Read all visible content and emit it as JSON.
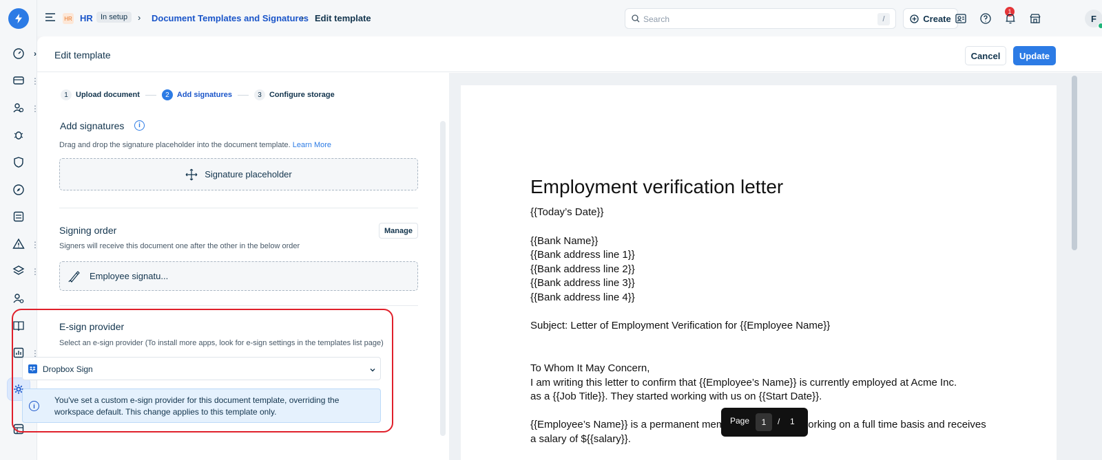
{
  "topbar": {
    "module": "HR",
    "module_status": "In setup",
    "crumb_parent": "Document Templates and Signatures",
    "crumb_current": "Edit template",
    "search_placeholder": "Search",
    "search_shortcut": "/",
    "create_label": "Create",
    "notification_count": "1",
    "avatar_initial": "F"
  },
  "header": {
    "title": "Edit template",
    "cancel_label": "Cancel",
    "update_label": "Update"
  },
  "steps": [
    {
      "num": "1",
      "label": "Upload document"
    },
    {
      "num": "2",
      "label": "Add signatures"
    },
    {
      "num": "3",
      "label": "Configure storage"
    }
  ],
  "signatures": {
    "title": "Add signatures",
    "desc": "Drag and drop the signature placeholder into the document template.",
    "learn_more": "Learn More",
    "placeholder_label": "Signature placeholder"
  },
  "signing_order": {
    "title": "Signing order",
    "manage_label": "Manage",
    "desc": "Signers will receive this document one after the other in the below order",
    "signer_label": "Employee signatu..."
  },
  "esign": {
    "title": "E-sign provider",
    "desc": "Select an e-sign provider (To install more apps, look for e-sign settings in the templates list page)",
    "selected_provider": "Dropbox Sign",
    "note": "You've set a custom e-sign provider for this document template, overriding the workspace default. This change applies to this template only."
  },
  "document": {
    "title": "Employment verification letter",
    "lines": [
      "{{Today’s Date}}",
      "{{Bank Name}}",
      "{{Bank address line 1}}",
      "{{Bank address line 2}}",
      "{{Bank address line 3}}",
      "{{Bank address line 4}}",
      "Subject: Letter of Employment Verification for {{Employee Name}}",
      "To Whom It May Concern,",
      "I am writing this letter to confirm that {{Employee’s Name}} is currently employed at Acme Inc.",
      "as a {{Job Title}}. They started working with us on {{Start Date}}.",
      "{{Employee’s Name}} is a permanent member of our team, working on a full time basis and receives",
      "a salary of ${{salary}}."
    ]
  },
  "pager": {
    "label": "Page",
    "current": "1",
    "separator": "/",
    "total": "1"
  },
  "colors": {
    "accent": "#2c7be5",
    "highlight_frame": "#e01f2a",
    "note_bg": "#e5f1fd"
  }
}
